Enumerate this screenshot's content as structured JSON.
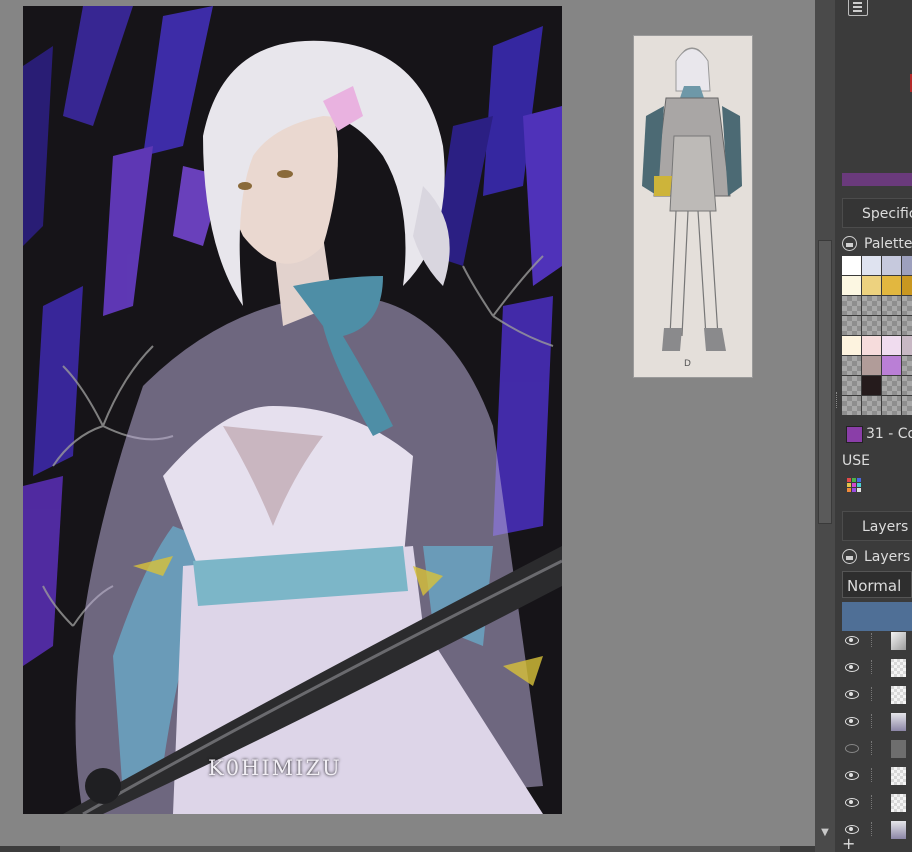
{
  "artwork": {
    "signature": "K0HIMIZU"
  },
  "docker": {
    "specific_tab": "Specific",
    "palette_title": "Palette",
    "current_color_label": "31 - Co",
    "use_label": "USE",
    "layers_tab": "Layers",
    "layers_title": "Layers",
    "blend_mode": "Normal",
    "add_layer_symbol": "+"
  },
  "palette_colors": [
    [
      "#ffffff",
      "#dfe3f0",
      "#c6c9dd",
      "#9da0bd"
    ],
    [
      "#fcf7e2",
      "#edd27f",
      "#e2b73f",
      "#c99720"
    ],
    [
      "checker",
      "checker",
      "checker",
      "checker"
    ],
    [
      "checker",
      "checker",
      "checker",
      "checker"
    ],
    [
      "#fdf3df",
      "#f6dcdc",
      "#f0dcef",
      "#c8b8c4"
    ],
    [
      "checker",
      "#b19c99",
      "#ba7fd6",
      "checker"
    ],
    [
      "checker",
      "#251b1c",
      "checker",
      "checker"
    ],
    [
      "checker",
      "checker",
      "checker",
      "checker"
    ]
  ],
  "layers": [
    {
      "visible": true,
      "thumb": "sketch"
    },
    {
      "visible": true,
      "thumb": "transparent"
    },
    {
      "visible": true,
      "thumb": "transparent"
    },
    {
      "visible": true,
      "thumb": "figure"
    },
    {
      "visible": false,
      "thumb": "gray"
    },
    {
      "visible": true,
      "thumb": "transparent"
    },
    {
      "visible": true,
      "thumb": "transparent"
    },
    {
      "visible": true,
      "thumb": "figure"
    }
  ]
}
